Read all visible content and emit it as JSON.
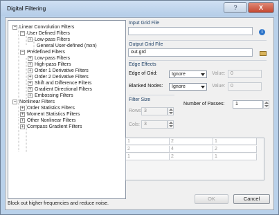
{
  "window": {
    "title": "Digital Filtering",
    "help_glyph": "?",
    "close_glyph": "X"
  },
  "tree": {
    "expander_minus": "−",
    "expander_plus": "+",
    "linear": "Linear Convolution Filters",
    "user_defined": "User Defined Filters",
    "low_pass_user": "Low-pass Filters",
    "general_user_defined": "General User-defined (mxn)",
    "predefined": "Predefined Filters",
    "low_pass": "Low-pass Filters",
    "high_pass": "High-pass Filters",
    "order1": "Order 1 Derivative Filters",
    "order2": "Order 2 Derivative Filters",
    "shift_diff": "Shift and Difference Filters",
    "gradient_dir": "Gradient Directional Filters",
    "embossing": "Embossing Filters",
    "nonlinear": "Nonlinear Filters",
    "order_stats": "Order Statistics Filters",
    "moment_stats": "Moment Statistics Filters",
    "other_nonlinear": "Other Nonlinear Filters",
    "compass_gradient": "Compass Gradient Filters"
  },
  "status_text": "Block out higher frequencies and reduce noise.",
  "input_grid": {
    "label": "Input Grid File",
    "value": "",
    "icon": "info-icon"
  },
  "output_grid": {
    "label": "Output Grid File",
    "value": "out.grd",
    "icon": "folder-open-icon"
  },
  "edge_effects": {
    "label": "Edge Effects",
    "edge_of_grid_label": "Edge of Grid:",
    "edge_of_grid_value": "Ignore",
    "blanked_nodes_label": "Blanked Nodes:",
    "blanked_nodes_value": "Ignore",
    "value_label": "Value:",
    "value_1": "0",
    "value_2": "0"
  },
  "filter_size": {
    "label": "Filter Size",
    "rows_label": "Rows:",
    "rows_value": "3",
    "cols_label": "Cols:",
    "cols_value": "3"
  },
  "passes": {
    "label": "Number of Passes:",
    "value": "1"
  },
  "kernel": [
    [
      "1",
      "2",
      "1"
    ],
    [
      "2",
      "4",
      "2"
    ],
    [
      "1",
      "2",
      "1"
    ]
  ],
  "buttons": {
    "ok": "OK",
    "cancel": "Cancel"
  },
  "colors": {
    "window_frame": "#b9d1ea",
    "close_button": "#c4462f",
    "group_title_text": "#1f4166"
  }
}
